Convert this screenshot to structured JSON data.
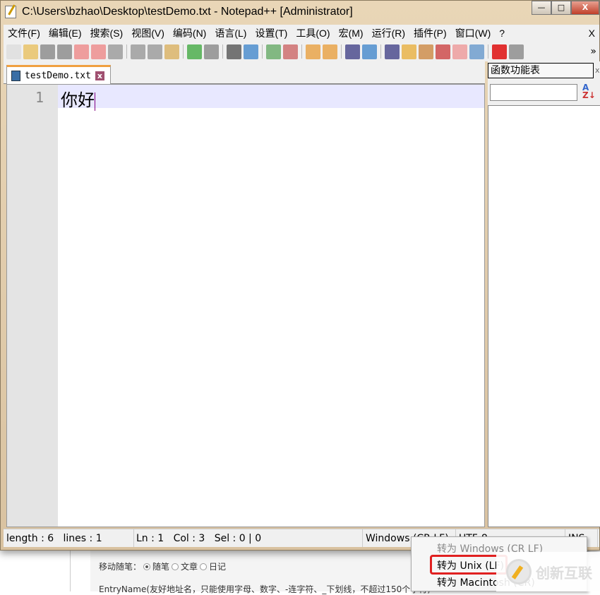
{
  "window": {
    "title": "C:\\Users\\bzhao\\Desktop\\testDemo.txt - Notepad++ [Administrator]",
    "min": "—",
    "max": "□",
    "close": "X"
  },
  "menu": [
    "文件(F)",
    "编辑(E)",
    "搜索(S)",
    "视图(V)",
    "编码(N)",
    "语言(L)",
    "设置(T)",
    "工具(O)",
    "宏(M)",
    "运行(R)",
    "插件(P)",
    "窗口(W)",
    "?"
  ],
  "menu_close": "X",
  "toolbar": {
    "icons": [
      "new-file",
      "open-file",
      "save",
      "save-all",
      "close",
      "close-all",
      "print",
      "cut",
      "copy",
      "paste",
      "undo",
      "redo",
      "find",
      "replace",
      "zoom-in",
      "zoom-out",
      "sync-vertical",
      "sync-horizontal",
      "word-wrap",
      "show-all-chars",
      "indent-guide",
      "user-defined-lang",
      "doc-map",
      "function-list",
      "folder-workspace",
      "monitor",
      "record-macro",
      "stop-record"
    ],
    "overflow": "»"
  },
  "tab": {
    "name": "testDemo.txt",
    "close": "x"
  },
  "editor": {
    "line_number": "1",
    "text": "你好"
  },
  "function_panel": {
    "title": "函数功能表",
    "close": "x",
    "sort_a": "A",
    "sort_z": "Z↓",
    "search_value": ""
  },
  "status": {
    "length": "length : 6",
    "lines": "lines : 1",
    "ln": "Ln : 1",
    "col": "Col : 3",
    "sel": "Sel : 0 | 0",
    "eol": "Windows (CR LF)",
    "encoding": "UTF-8",
    "mode": "INS"
  },
  "eol_menu": [
    "转为 Windows (CR LF)",
    "转为 Unix (LF)",
    "转为 Macintosh (CR)"
  ],
  "background_page": {
    "label": "移动随笔：",
    "options": [
      "随笔",
      "文章",
      "日记"
    ],
    "entry_text": "EntryName(友好地址名，只能使用字母、数字、-连字符、_下划线，不超过150个字符)"
  },
  "watermark": "创新互联",
  "colors": {
    "highlight_box": "#e02020",
    "current_line": "#e8e8ff",
    "tab_accent": "#f0a040"
  }
}
